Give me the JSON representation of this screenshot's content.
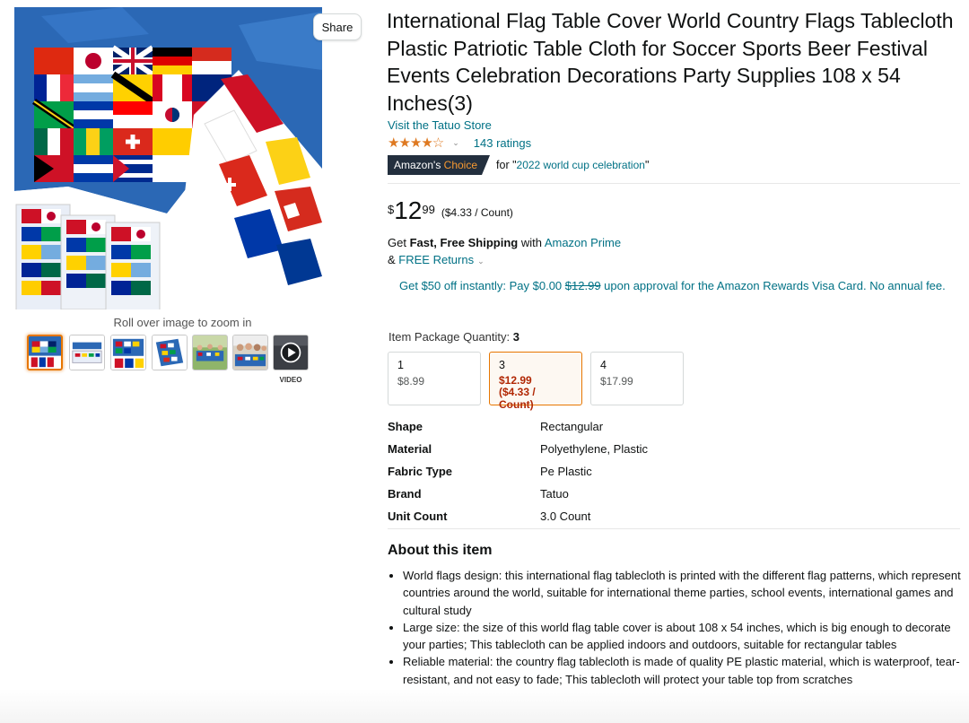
{
  "gallery": {
    "share_label": "Share",
    "zoom_hint": "Roll over image to zoom in",
    "video_label": "VIDEO",
    "thumbnails": [
      "product-photo",
      "product-packaging",
      "product-flat",
      "product-folded",
      "lifestyle-party",
      "lifestyle-crowd",
      "video"
    ]
  },
  "product": {
    "title": "International Flag Table Cover World Country Flags Tablecloth Plastic Patriotic Table Cloth for Soccer Sports Beer Festival Events Celebration Decorations Party Supplies 108 x 54 Inches(3)",
    "store_link": "Visit the Tatuo Store",
    "rating_stars": "★★★★☆",
    "rating_chevron": "⌄",
    "ratings_count": "143 ratings",
    "choice_badge_prefix": "Amazon's",
    "choice_badge_word": "Choice",
    "choice_for_prefix": "for \"",
    "choice_query": "2022 world cup celebration",
    "choice_for_suffix": "\""
  },
  "price": {
    "symbol": "$",
    "whole": "12",
    "fraction": "99",
    "per_unit": "($4.33 / Count)"
  },
  "shipping": {
    "get": "Get ",
    "fast_free": "Fast, Free Shipping",
    "with": " with ",
    "prime_link": "Amazon Prime",
    "amp": "& ",
    "returns_link": "FREE Returns",
    "returns_chevron": "⌄"
  },
  "promo": {
    "before": "Get $50 off instantly: Pay $0.00 ",
    "strike": "$12.99",
    "after": " upon approval for the Amazon Rewards Visa Card. No annual fee."
  },
  "quantity": {
    "label": "Item Package Quantity: ",
    "selected_value": "3",
    "options": [
      {
        "qty": "1",
        "price": "$8.99",
        "unit": ""
      },
      {
        "qty": "3",
        "price": "$12.99",
        "unit": "($4.33 / Count)"
      },
      {
        "qty": "4",
        "price": "$17.99",
        "unit": ""
      }
    ]
  },
  "specs": [
    {
      "key": "Shape",
      "value": "Rectangular"
    },
    {
      "key": "Material",
      "value": "Polyethylene, Plastic"
    },
    {
      "key": "Fabric Type",
      "value": "Pe Plastic"
    },
    {
      "key": "Brand",
      "value": "Tatuo"
    },
    {
      "key": "Unit Count",
      "value": "3.0 Count"
    }
  ],
  "about": {
    "title": "About this item",
    "bullets": [
      "World flags design: this international flag tablecloth is printed with the different flag patterns, which represent countries around the world, suitable for international theme parties, school events, international games and cultural study",
      "Large size: the size of this world flag table cover is about 108 x 54 inches, which is big enough to decorate your parties; This tablecloth can be applied indoors and outdoors, suitable for rectangular tables",
      "Reliable material: the country flag tablecloth is made of quality PE plastic material, which is waterproof, tear-resistant, and not easy to fade; This tablecloth will protect your table top from scratches"
    ]
  },
  "colors": {
    "link": "#007185",
    "star": "#de7921",
    "deal_red": "#b12704",
    "selected_border": "#e77600",
    "badge_bg": "#232f3e",
    "badge_accent": "#f69931"
  }
}
